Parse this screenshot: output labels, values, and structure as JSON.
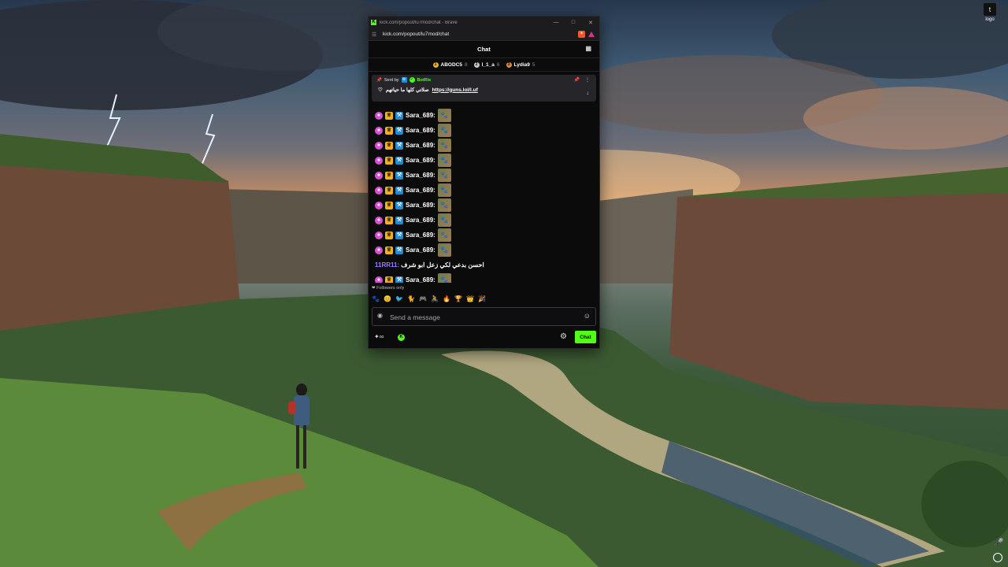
{
  "browser": {
    "title": "kick.com/popout/lu7mod/chat - Brave",
    "url": "kick.com/popout/lu7mod/chat"
  },
  "chat": {
    "header_title": "Chat",
    "leaderboard": [
      {
        "name": "ABODC5",
        "count": "8",
        "color": "#f4b01e"
      },
      {
        "name": "l_1_a",
        "count": "6",
        "color": "#c9c9cf"
      },
      {
        "name": "Lydia9",
        "count": "5",
        "color": "#d88a45"
      }
    ],
    "pinned": {
      "sent_by_label": "Sent by",
      "sender": "BotRix",
      "text": "صلاتي كلها ما حياتهم",
      "link": "https://guns.lol/l.uf"
    },
    "messages_top": [
      {
        "user": "Sara_689:"
      },
      {
        "user": "Sara_689:"
      },
      {
        "user": "Sara_689:"
      },
      {
        "user": "Sara_689:"
      },
      {
        "user": "Sara_689:"
      },
      {
        "user": "Sara_689:"
      },
      {
        "user": "Sara_689:"
      },
      {
        "user": "Sara_689:"
      },
      {
        "user": "Sara_689:"
      },
      {
        "user": "Sara_689:"
      }
    ],
    "message_ar": {
      "user": "11RR11:",
      "text": "احسن بدعي لكي زعل ابو شرف"
    },
    "message_last": {
      "user": "Sara_689:"
    },
    "followers_only_label": "Followers only",
    "input_placeholder": "Send a message",
    "chat_button_label": "Chat"
  },
  "desktop": {
    "logo_label": "logo"
  }
}
